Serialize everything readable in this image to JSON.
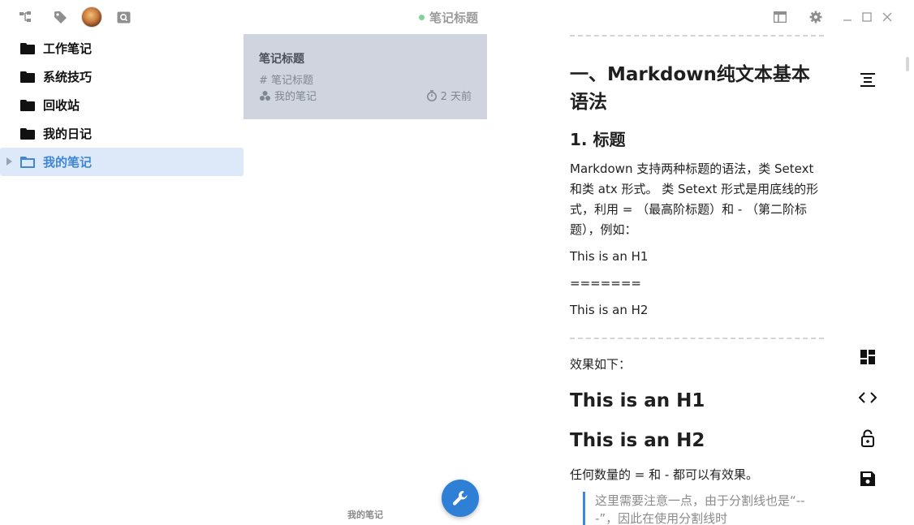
{
  "topbar": {
    "icons": [
      "tree-icon",
      "tag-icon",
      "avatar",
      "search-icon"
    ],
    "title": "笔记标题",
    "right_icons": [
      "layout-icon",
      "gear-icon",
      "minimize-icon",
      "maximize-icon",
      "close-icon"
    ]
  },
  "sidebar": {
    "items": [
      {
        "label": "工作笔记",
        "active": false
      },
      {
        "label": "系统技巧",
        "active": false
      },
      {
        "label": "回收站",
        "active": false
      },
      {
        "label": "我的日记",
        "active": false
      },
      {
        "label": "我的笔记",
        "active": true
      }
    ]
  },
  "notelist": {
    "card": {
      "title": "笔记标题",
      "snippet": "# 笔记标题",
      "notebook": "我的笔记",
      "time": "2 天前"
    },
    "footer": "我的笔记"
  },
  "editor": {
    "h1": "一、Markdown纯文本基本语法",
    "h2": "1. 标题",
    "p1": "Markdown 支持两种标题的语法，类 Setext 和类 atx 形式。 类 Setext 形式是用底线的形式，利用 = （最高阶标题）和 - （第二阶标题），例如：",
    "p2": "This is an H1",
    "p3": "=======",
    "p4": "This is an H2",
    "p5": "效果如下：",
    "big1": "This is an H1",
    "big2": "This is an H2",
    "p6": "任何数量的 = 和 - 都可以有效果。",
    "quote": "这里需要注意一点，由于分割线也是“---”，因此在使用分割线时"
  },
  "right_toolbar": [
    "align-center-icon",
    "dashboard-icon",
    "code-icon",
    "unlock-icon",
    "save-icon"
  ],
  "colors": {
    "accent": "#3f86d6",
    "sidebar_active_bg": "#dde9f8",
    "card_bg": "#cfd4de",
    "status_dot": "#7fd39a",
    "fab": "#2f7fd6"
  }
}
